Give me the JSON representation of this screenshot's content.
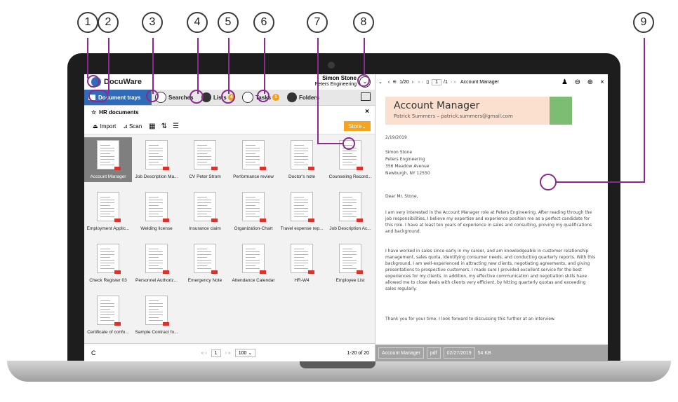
{
  "callouts": [
    "1",
    "2",
    "3",
    "4",
    "5",
    "6",
    "7",
    "8",
    "9"
  ],
  "app": {
    "logo": "DocuWare",
    "user_name": "Simon Stone",
    "user_org": "Peters Engineering"
  },
  "tabs": {
    "document_trays": "Document trays",
    "searches": "Searches",
    "lists": "Lists",
    "lists_badge": "4",
    "tasks": "Tasks",
    "tasks_badge": "1",
    "folders": "Folders"
  },
  "tray": {
    "title": "HR documents",
    "close": "×"
  },
  "toolbar": {
    "import": "Import",
    "scan": "Scan",
    "store": "Store"
  },
  "documents": [
    "Account Manager",
    "Job Description Ma...",
    "CV Peter Strom",
    "Performance review",
    "Doctor's note",
    "Counseling Record...",
    "Employment Applic...",
    "Welding license",
    "Insurance claim",
    "Organization-Chart",
    "Travel expense rep...",
    "Job Description Ac...",
    "Check Register 03",
    "Personnel Authoriz...",
    "Emergency Note",
    "Attendance Calendar",
    "HR-W4",
    "Employee List",
    "Certificate of confo...",
    "Sample Contract fo..."
  ],
  "footer": {
    "refresh": "C",
    "page": "1",
    "page_size": "100",
    "range": "1-20 of 20"
  },
  "viewer": {
    "count": "1/20",
    "page": "1",
    "pages": "/1",
    "doc_name": "Account Manager"
  },
  "letter": {
    "title": "Account Manager",
    "subtitle": "Patrick Summers – patrick.summers@gmail.com",
    "date": "2/19/2019",
    "addr1": "Simon Stone",
    "addr2": "Peters Engineering",
    "addr3": "356 Meadow Avenue",
    "addr4": "Newburgh, NY 12550",
    "greeting": "Dear Mr. Stone,",
    "p1": "I am very interested in the Account Manager role at Peters Engineering. After reading through the job responsibilities, I believe my expertise and experience position me as a perfect candidate for this role. I have at least ten years of experience in sales and consulting, proving my qualifications and background.",
    "p2": "I have worked in sales since early in my career, and am knowledgeable in customer relationship management, sales quota, identifying consumer needs, and conducting quarterly reports. With this background, I am well-experienced in attracting new clients, negotiating agreements, and giving presentations to prospective customers. I made sure I provided excellent service for the best experiences for my clients. In addition, my effective communication and negotiation skills have allowed me to close deals with clients very efficient, by hitting quarterly quotas and exceeding sales regularly.",
    "p3": "Thank you for your time. I look forward to discussing this further at an interview."
  },
  "status": {
    "name": "Account Manager",
    "type": "pdf",
    "date": "02/27/2019",
    "size": "54 KB"
  },
  "colors": {
    "accent": "#8a2a8e",
    "tab_active": "#2f6bb7",
    "store": "#f3a522",
    "badge": "#f1a121"
  }
}
